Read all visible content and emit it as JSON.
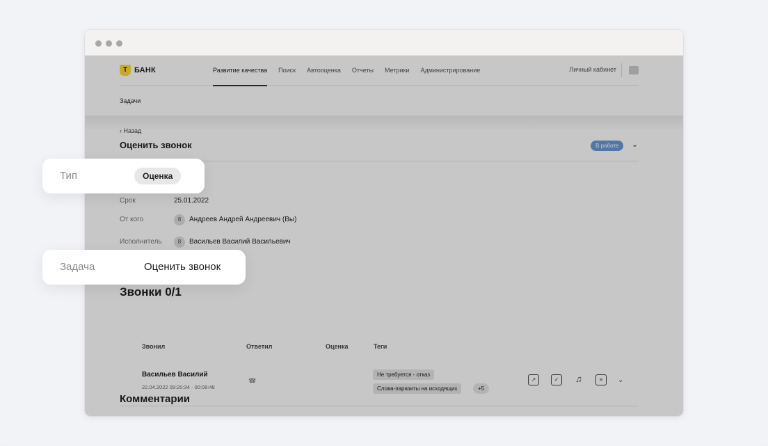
{
  "browser": {
    "dots": [
      "#a7a7a7",
      "#a7a7a7",
      "#a7a7a7"
    ]
  },
  "brand": {
    "logo_letter": "Т",
    "logo_text": "БАНК",
    "accent": "#ffdd2d"
  },
  "nav": {
    "items": [
      "Развитие качества",
      "Поиск",
      "Автооценка",
      "Отчеты",
      "Метрики",
      "Администрирование"
    ],
    "active_index": 0,
    "cabinet": "Личный кабинет"
  },
  "subnav": {
    "tab": "Задачи"
  },
  "page": {
    "back": "Назад",
    "title": "Оценить звонок",
    "status": "В работе",
    "status_color": "#6c98d6"
  },
  "fields": {
    "deadline_label": "Срок",
    "deadline": "25.01.2022",
    "from_label": "От кого",
    "from": "Андреев Андрей Андреевич (Вы)",
    "assignee_label": "Исполнитель",
    "assignee": "Васильев Василий Васильевич"
  },
  "calls": {
    "heading": "Звонки 0/1",
    "columns": [
      "Звонил",
      "Ответил",
      "Оценка",
      "Теги"
    ],
    "row": {
      "caller": "Васильев Василий",
      "meta": "22.04.2022 09:20:34 · 00:08:48",
      "tags": [
        "Не требуется - отказ",
        "Слова-паразиты на исходящих"
      ],
      "more_tags": "+5",
      "actions": [
        "share-icon",
        "clipboard-check-icon",
        "music-icon",
        "chat-icon"
      ]
    }
  },
  "comments": {
    "heading": "Комментарии"
  },
  "highlight": {
    "type_label": "Тип",
    "type_value": "Оценка",
    "task_label": "Задача",
    "task_value": "Оценить звонок"
  }
}
